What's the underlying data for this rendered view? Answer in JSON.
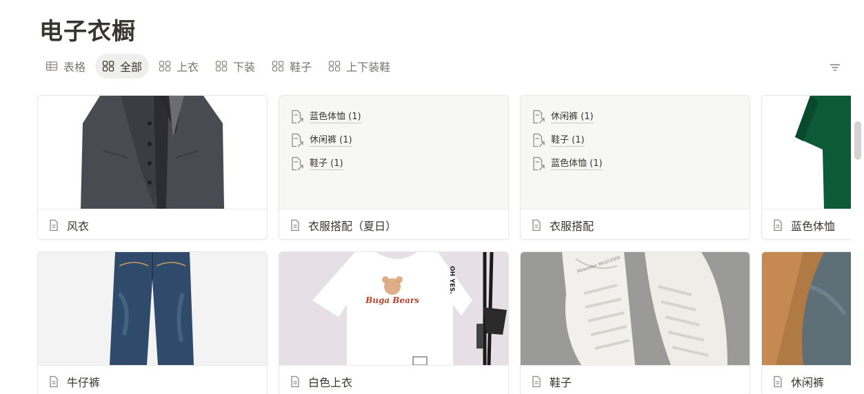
{
  "page": {
    "title": "电子衣橱"
  },
  "tabs": [
    {
      "label": "表格",
      "icon": "table-icon",
      "active": false
    },
    {
      "label": "全部",
      "icon": "gallery-icon",
      "active": true
    },
    {
      "label": "上衣",
      "icon": "gallery-icon",
      "active": false
    },
    {
      "label": "下装",
      "icon": "gallery-icon",
      "active": false
    },
    {
      "label": "鞋子",
      "icon": "gallery-icon",
      "active": false
    },
    {
      "label": "上下装鞋",
      "icon": "gallery-icon",
      "active": false
    }
  ],
  "toolbar": {
    "filter_icon": "filter-icon"
  },
  "cards": [
    {
      "name": "风衣",
      "cover": "image",
      "cover_subject": "coat"
    },
    {
      "name": "衣服搭配（夏日）",
      "cover": "relations",
      "relations": [
        "蓝色体恤 (1)",
        "休闲裤 (1)",
        "鞋子 (1)"
      ]
    },
    {
      "name": "衣服搭配",
      "cover": "relations",
      "relations": [
        "休闲裤 (1)",
        "鞋子 (1)",
        "蓝色体恤 (1)"
      ]
    },
    {
      "name": "蓝色体恤",
      "cover": "image",
      "cover_subject": "green-tshirt"
    },
    {
      "name": "牛仔裤",
      "cover": "image",
      "cover_subject": "jeans"
    },
    {
      "name": "白色上衣",
      "cover": "image",
      "cover_subject": "white-tshirt",
      "cover_text": [
        "Buga Bears",
        "OH YES."
      ]
    },
    {
      "name": "鞋子",
      "cover": "image",
      "cover_subject": "sneakers",
      "cover_text": [
        "Alexander McQUEEN"
      ]
    },
    {
      "name": "休闲裤",
      "cover": "image",
      "cover_subject": "casual-pants"
    }
  ],
  "colors": {
    "text": "#37352f",
    "muted": "#787774",
    "active_tab_bg": "#efefed",
    "card_border": "#e6e6e4",
    "text_cover_bg": "#f7f7f5"
  }
}
